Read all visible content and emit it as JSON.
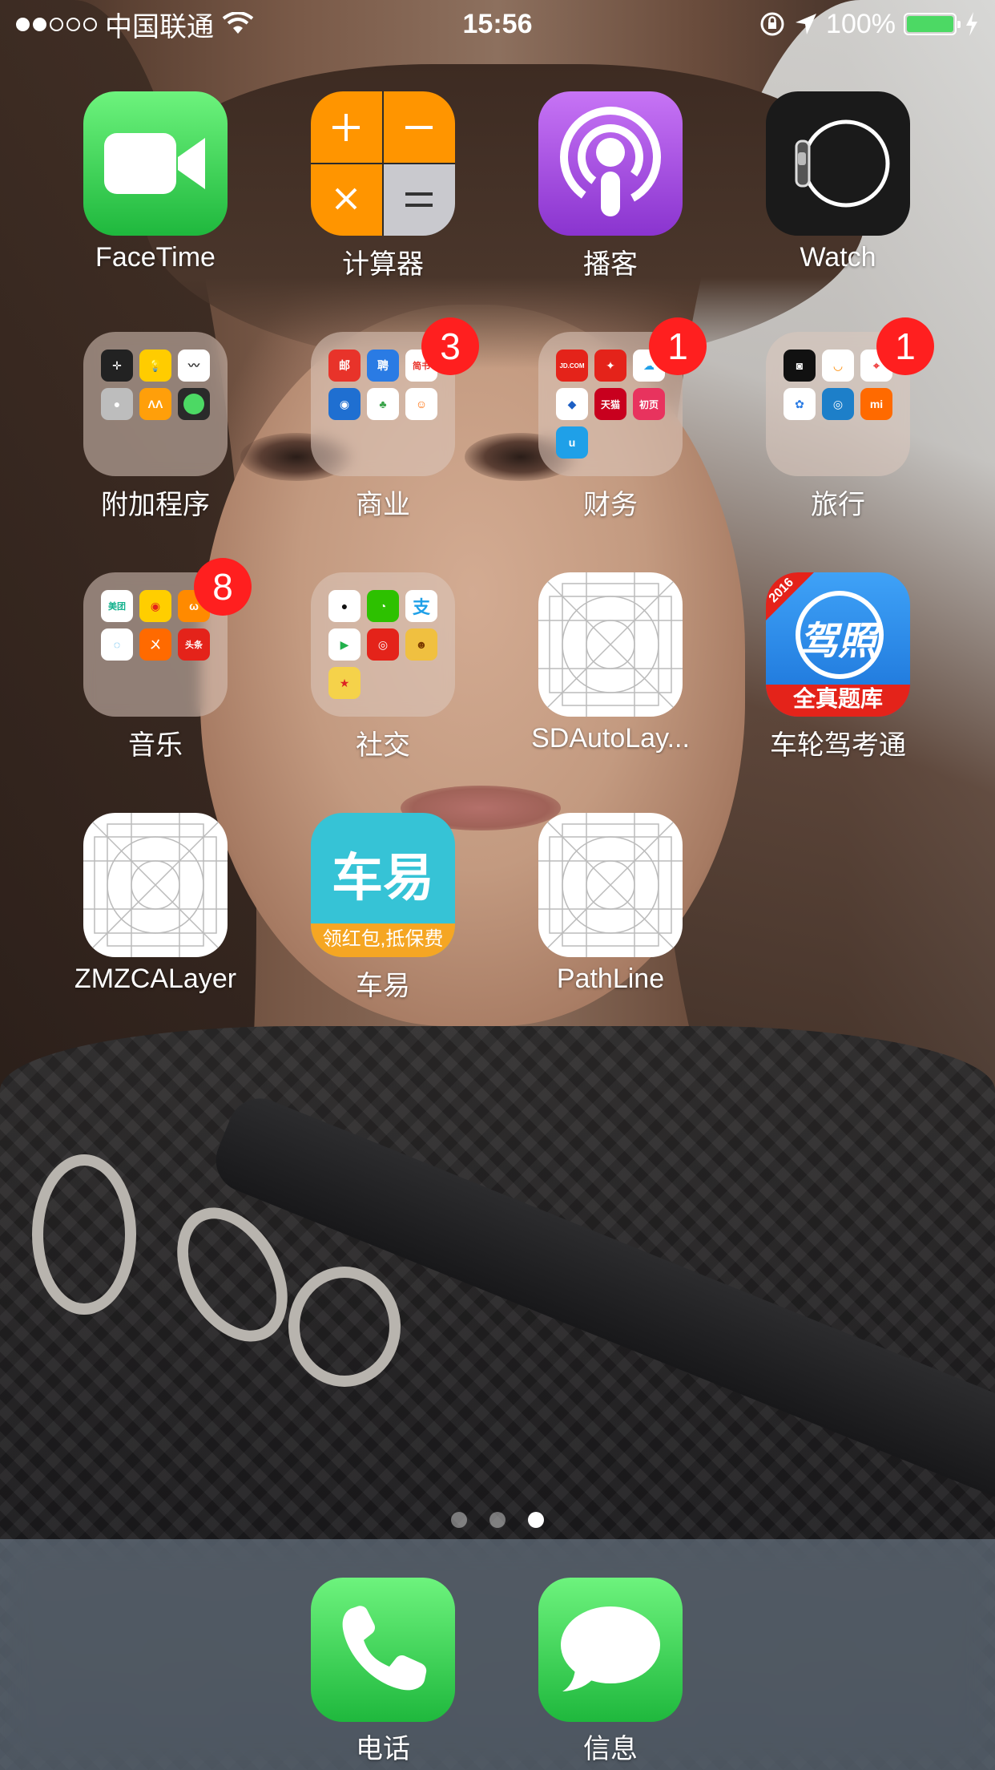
{
  "status_bar": {
    "carrier": "中国联通",
    "time": "15:56",
    "battery": "100%",
    "signal_bars_filled": 2,
    "signal_bars_total": 5
  },
  "apps": {
    "facetime": {
      "label": "FaceTime"
    },
    "calculator": {
      "label": "计算器"
    },
    "podcasts": {
      "label": "播客"
    },
    "watch": {
      "label": "Watch"
    },
    "extras_folder": {
      "label": "附加程序"
    },
    "business_folder": {
      "label": "商业",
      "badge": "3",
      "mini_texts": [
        "邮",
        "聘",
        "简书",
        "",
        "",
        ""
      ]
    },
    "finance_folder": {
      "label": "财务",
      "badge": "1",
      "mini_texts": [
        "JD.COM",
        "",
        "",
        "",
        "天猫",
        "初页"
      ]
    },
    "travel_folder": {
      "label": "旅行",
      "badge": "1"
    },
    "music_folder": {
      "label": "音乐",
      "badge": "8",
      "mini_texts": [
        "美团",
        "",
        "",
        "",
        "",
        "头条"
      ]
    },
    "social_folder": {
      "label": "社交",
      "mini_texts": [
        "",
        "",
        "支"
      ]
    },
    "sdautolayout": {
      "label": "SDAutoLay..."
    },
    "driving_test": {
      "label": "车轮驾考通",
      "year": "2016",
      "logo_text": "驾照",
      "banner": "全真题库"
    },
    "zmzcalayer": {
      "label": "ZMZCALayer"
    },
    "cheyi": {
      "label": "车易",
      "logo_text": "车易",
      "banner": "领红包,抵保费"
    },
    "pathline": {
      "label": "PathLine"
    }
  },
  "page_dots": {
    "count": 3,
    "active": 2
  },
  "dock": {
    "phone": {
      "label": "电话"
    },
    "messages": {
      "label": "信息"
    }
  },
  "colors": {
    "badge": "#ff1f1f",
    "facetime_green": "#4cd964",
    "calculator_orange": "#ff9500",
    "podcasts_purple": "#9b4ddb"
  }
}
